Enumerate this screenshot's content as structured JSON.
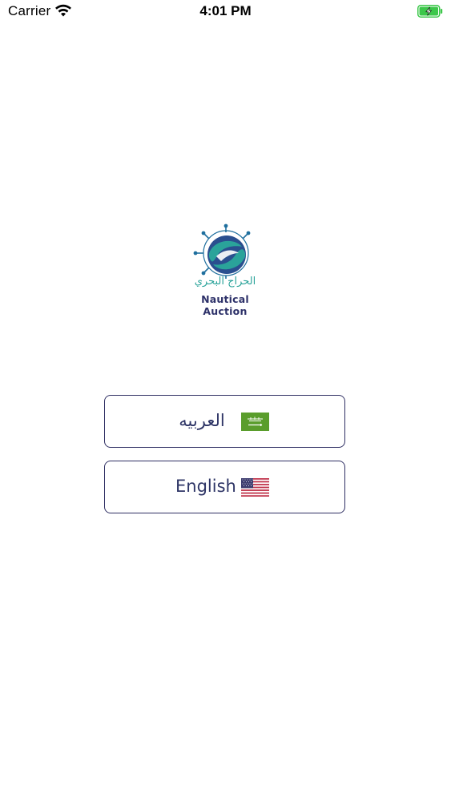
{
  "status_bar": {
    "carrier": "Carrier",
    "time": "4:01 PM",
    "battery_color": "#3cc74a"
  },
  "logo": {
    "arabic_text": "الحراج البحري",
    "english_text": "Nautical Auction",
    "colors": {
      "teal": "#2aa39a",
      "navy": "#2d3169",
      "blue": "#1f6f9e"
    }
  },
  "language_options": [
    {
      "label": "العربيه",
      "flag": "saudi-flag-icon"
    },
    {
      "label": "English",
      "flag": "us-flag-icon"
    }
  ],
  "colors": {
    "button_border": "#2f2f63",
    "button_text": "#2e3566",
    "saudi_green": "#5a9d2c",
    "us_red": "#c0324a",
    "us_blue": "#3c3b6e"
  }
}
